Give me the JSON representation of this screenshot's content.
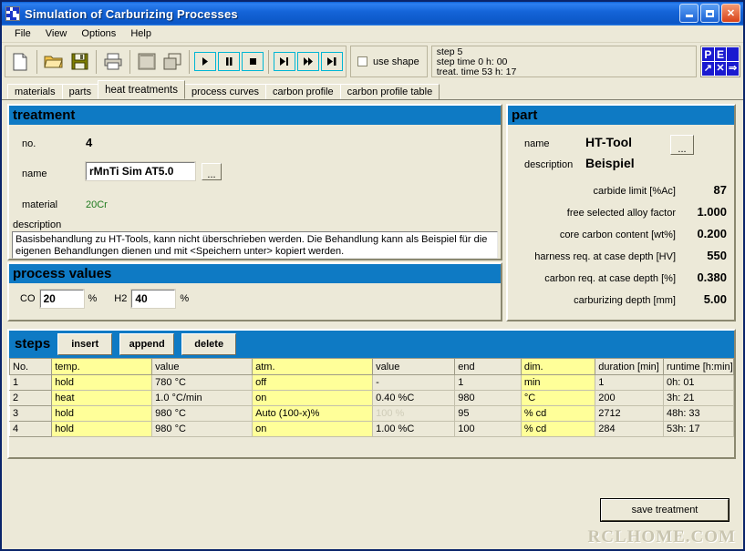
{
  "window": {
    "title": "Simulation of Carburizing Processes",
    "icon": "app-grid-icon",
    "controls": {
      "minimize": "_",
      "maximize": "□",
      "close": "✕"
    }
  },
  "menu": {
    "items": [
      "File",
      "View",
      "Options",
      "Help"
    ]
  },
  "toolbar": {
    "buttons": [
      {
        "name": "new-file",
        "icon": "page-icon"
      },
      {
        "name": "open-file",
        "icon": "folder-open-icon"
      },
      {
        "name": "save-file",
        "icon": "floppy-disk-icon"
      },
      {
        "name": "print",
        "icon": "printer-icon"
      },
      {
        "name": "copy-window",
        "icon": "window-icon"
      },
      {
        "name": "duplicate",
        "icon": "copy-icon"
      },
      {
        "name": "play",
        "icon": "play-icon"
      },
      {
        "name": "pause",
        "icon": "pause-icon"
      },
      {
        "name": "stop",
        "icon": "stop-icon"
      },
      {
        "name": "step-forward",
        "icon": "step-icon"
      },
      {
        "name": "fast-forward",
        "icon": "fast-forward-icon"
      },
      {
        "name": "skip-end",
        "icon": "skip-end-icon"
      }
    ],
    "use_shape_label": "use shape",
    "use_shape_checked": false,
    "logo_cells": [
      "P",
      "E",
      "",
      "",
      "",
      ""
    ]
  },
  "status": {
    "line1": "step 5",
    "line2": "step time 0 h: 00",
    "line3": "treat. time 53 h: 17"
  },
  "tabs": [
    {
      "label": "materials",
      "active": false
    },
    {
      "label": "parts",
      "active": false
    },
    {
      "label": "heat treatments",
      "active": true
    },
    {
      "label": "process curves",
      "active": false
    },
    {
      "label": "carbon profile",
      "active": false
    },
    {
      "label": "carbon profile table",
      "active": false
    }
  ],
  "treatment": {
    "title": "treatment",
    "no_label": "no.",
    "no_value": "4",
    "name_label": "name",
    "name_value": "rMnTi Sim AT5.0",
    "browse_label": "...",
    "material_label": "material",
    "material_value": "20Cr",
    "description_label": "description",
    "description_value": "Basisbehandlung zu HT-Tools, kann nicht überschrieben werden. Die Behandlung kann als Beispiel für die eigenen Behandlungen dienen und mit <Speichern unter> kopiert werden."
  },
  "process_values": {
    "title": "process values",
    "co_label": "CO",
    "co_value": "20",
    "co_unit": "%",
    "h2_label": "H2",
    "h2_value": "40",
    "h2_unit": "%"
  },
  "part": {
    "title": "part",
    "name_label": "name",
    "name_value": "HT-Tool",
    "browse_label": "...",
    "description_label": "description",
    "description_value": "Beispiel",
    "rows": [
      {
        "label": "carbide limit [%Ac]",
        "value": "87"
      },
      {
        "label": "free selected alloy factor",
        "value": "1.000"
      },
      {
        "label": "core carbon content [wt%]",
        "value": "0.200"
      },
      {
        "label": "harness req. at case depth [HV]",
        "value": "550"
      },
      {
        "label": "carbon req. at case depth [%]",
        "value": "0.380"
      },
      {
        "label": "carburizing depth [mm]",
        "value": "5.00"
      }
    ]
  },
  "steps": {
    "title": "steps",
    "buttons": [
      "insert",
      "append",
      "delete"
    ],
    "columns": [
      "No.",
      "temp.",
      "value",
      "atm.",
      "value",
      "end",
      "dim.",
      "duration [min]",
      "runtime [h:min]"
    ],
    "rows": [
      {
        "no": "1",
        "temp": "hold",
        "temp_value": "780 °C",
        "atm": "off",
        "atm_value": "-",
        "end": "1",
        "dim": "min",
        "duration": "1",
        "runtime": "0h: 01",
        "atm_value_dim": false
      },
      {
        "no": "2",
        "temp": "heat",
        "temp_value": "1.0 °C/min",
        "atm": "on",
        "atm_value": "0.40 %C",
        "end": "980",
        "dim": "°C",
        "duration": "200",
        "runtime": "3h: 21",
        "atm_value_dim": false
      },
      {
        "no": "3",
        "temp": "hold",
        "temp_value": "980 °C",
        "atm": "Auto (100-x)%",
        "atm_value": "100 %",
        "end": "95",
        "dim": "% cd",
        "duration": "2712",
        "runtime": "48h: 33",
        "atm_value_dim": true
      },
      {
        "no": "4",
        "temp": "hold",
        "temp_value": "980 °C",
        "atm": "on",
        "atm_value": "1.00 %C",
        "end": "100",
        "dim": "% cd",
        "duration": "284",
        "runtime": "53h: 17",
        "atm_value_dim": false
      }
    ]
  },
  "save_treatment_label": "save treatment",
  "watermark": "RCLHOME.COM",
  "colors": {
    "header_blue": "#0e7ac4",
    "title_blue": "#1464d8",
    "face": "#ece9d8",
    "highlight_yellow": "#ffff99",
    "material_green": "#1d7a1d"
  }
}
